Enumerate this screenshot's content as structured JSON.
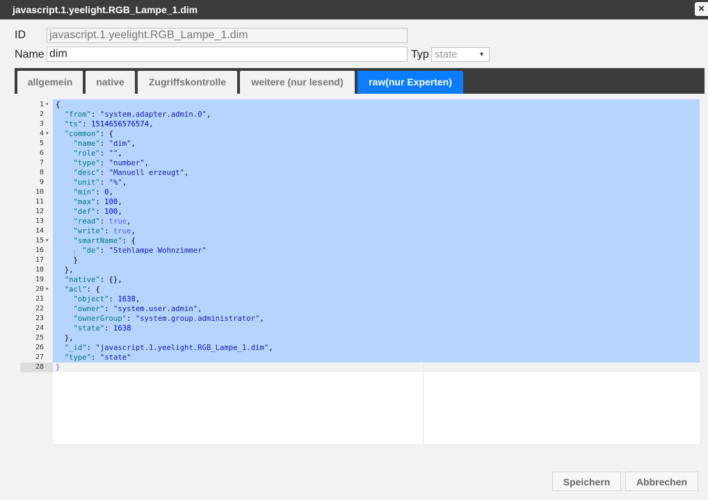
{
  "dialog": {
    "title": "javascript.1.yeelight.RGB_Lampe_1.dim",
    "close_symbol": "×"
  },
  "form": {
    "id_label": "ID",
    "id_value": "javascript.1.yeelight.RGB_Lampe_1.dim",
    "name_label": "Name",
    "name_value": "dim",
    "typ_label": "Typ",
    "typ_value": "state",
    "typ_arrow": "▼"
  },
  "tabs": [
    {
      "label": "allgemein"
    },
    {
      "label": "native"
    },
    {
      "label": "Zugriffskontrolle"
    },
    {
      "label": "weitere (nur lesend)"
    },
    {
      "label": "raw(nur Experten)"
    }
  ],
  "active_tab": "raw(nur Experten)",
  "editor": {
    "line_numbers": [
      "1",
      "2",
      "3",
      "4",
      "5",
      "6",
      "7",
      "8",
      "9",
      "10",
      "11",
      "12",
      "13",
      "14",
      "15",
      "16",
      "17",
      "18",
      "19",
      "20",
      "21",
      "22",
      "23",
      "24",
      "25",
      "26",
      "27",
      "28"
    ],
    "fold_marker": "▾",
    "folded_lines": [
      "1",
      "4",
      "15",
      "20"
    ],
    "active_line": "28"
  },
  "json_text": {
    "from": "system.adapter.admin.0",
    "ts": "1514656576574",
    "name": "dim",
    "role": "",
    "type": "number",
    "desc": "Manuell erzeugt",
    "unit": "%",
    "min": "0",
    "max": "100",
    "def": "100",
    "read": "true",
    "write": "true",
    "smartName_de": "Stehlampe Wohnzimmer",
    "object": "1638",
    "owner": "system.user.admin",
    "ownerGroup": "system.group.administrator",
    "state": "1638",
    "_id": "javascript.1.yeelight.RGB_Lampe_1.dim",
    "obj_type": "state"
  },
  "footer": {
    "save_label": "Speichern",
    "cancel_label": "Abbrechen"
  },
  "colors": {
    "titlebar": "#3c3c3c",
    "active_tab": "#0a7cff",
    "selection": "#b5d5ff"
  }
}
